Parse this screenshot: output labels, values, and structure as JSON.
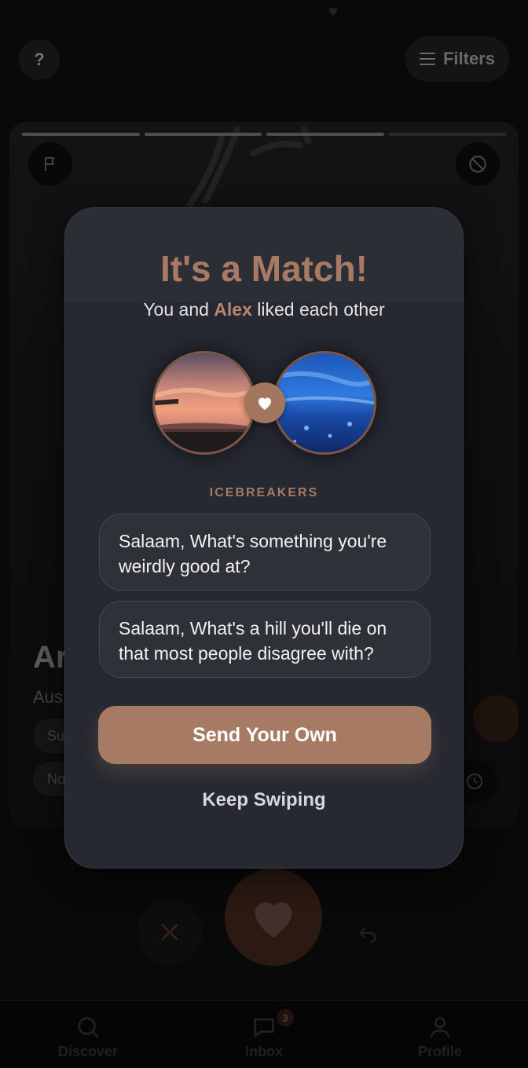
{
  "app": {
    "help_label": "?",
    "filters_label": "Filters",
    "card": {
      "name_partial": "Ar",
      "location_partial": "Aus",
      "chip_1_partial": "Su",
      "chip_2_partial": "No"
    },
    "tabs": [
      {
        "label": "Discover",
        "icon": "search-icon"
      },
      {
        "label": "Inbox",
        "icon": "chat-icon",
        "badge": "3"
      },
      {
        "label": "Profile",
        "icon": "person-icon"
      }
    ]
  },
  "match_modal": {
    "title": "It's a Match!",
    "subtitle_pre": "You and ",
    "subtitle_name": "Alex",
    "subtitle_post": " liked each other",
    "icebreakers_label": "ICEBREAKERS",
    "icebreakers": [
      "Salaam, What's something you're weirdly good at?",
      "Salaam, What's a hill you'll die on that most people disagree with?"
    ],
    "send_button": "Send Your Own",
    "keep_button": "Keep Swiping"
  },
  "colors": {
    "accent": "#a77b63",
    "modal_bg": "#262931",
    "card_bg": "#2f3138"
  }
}
